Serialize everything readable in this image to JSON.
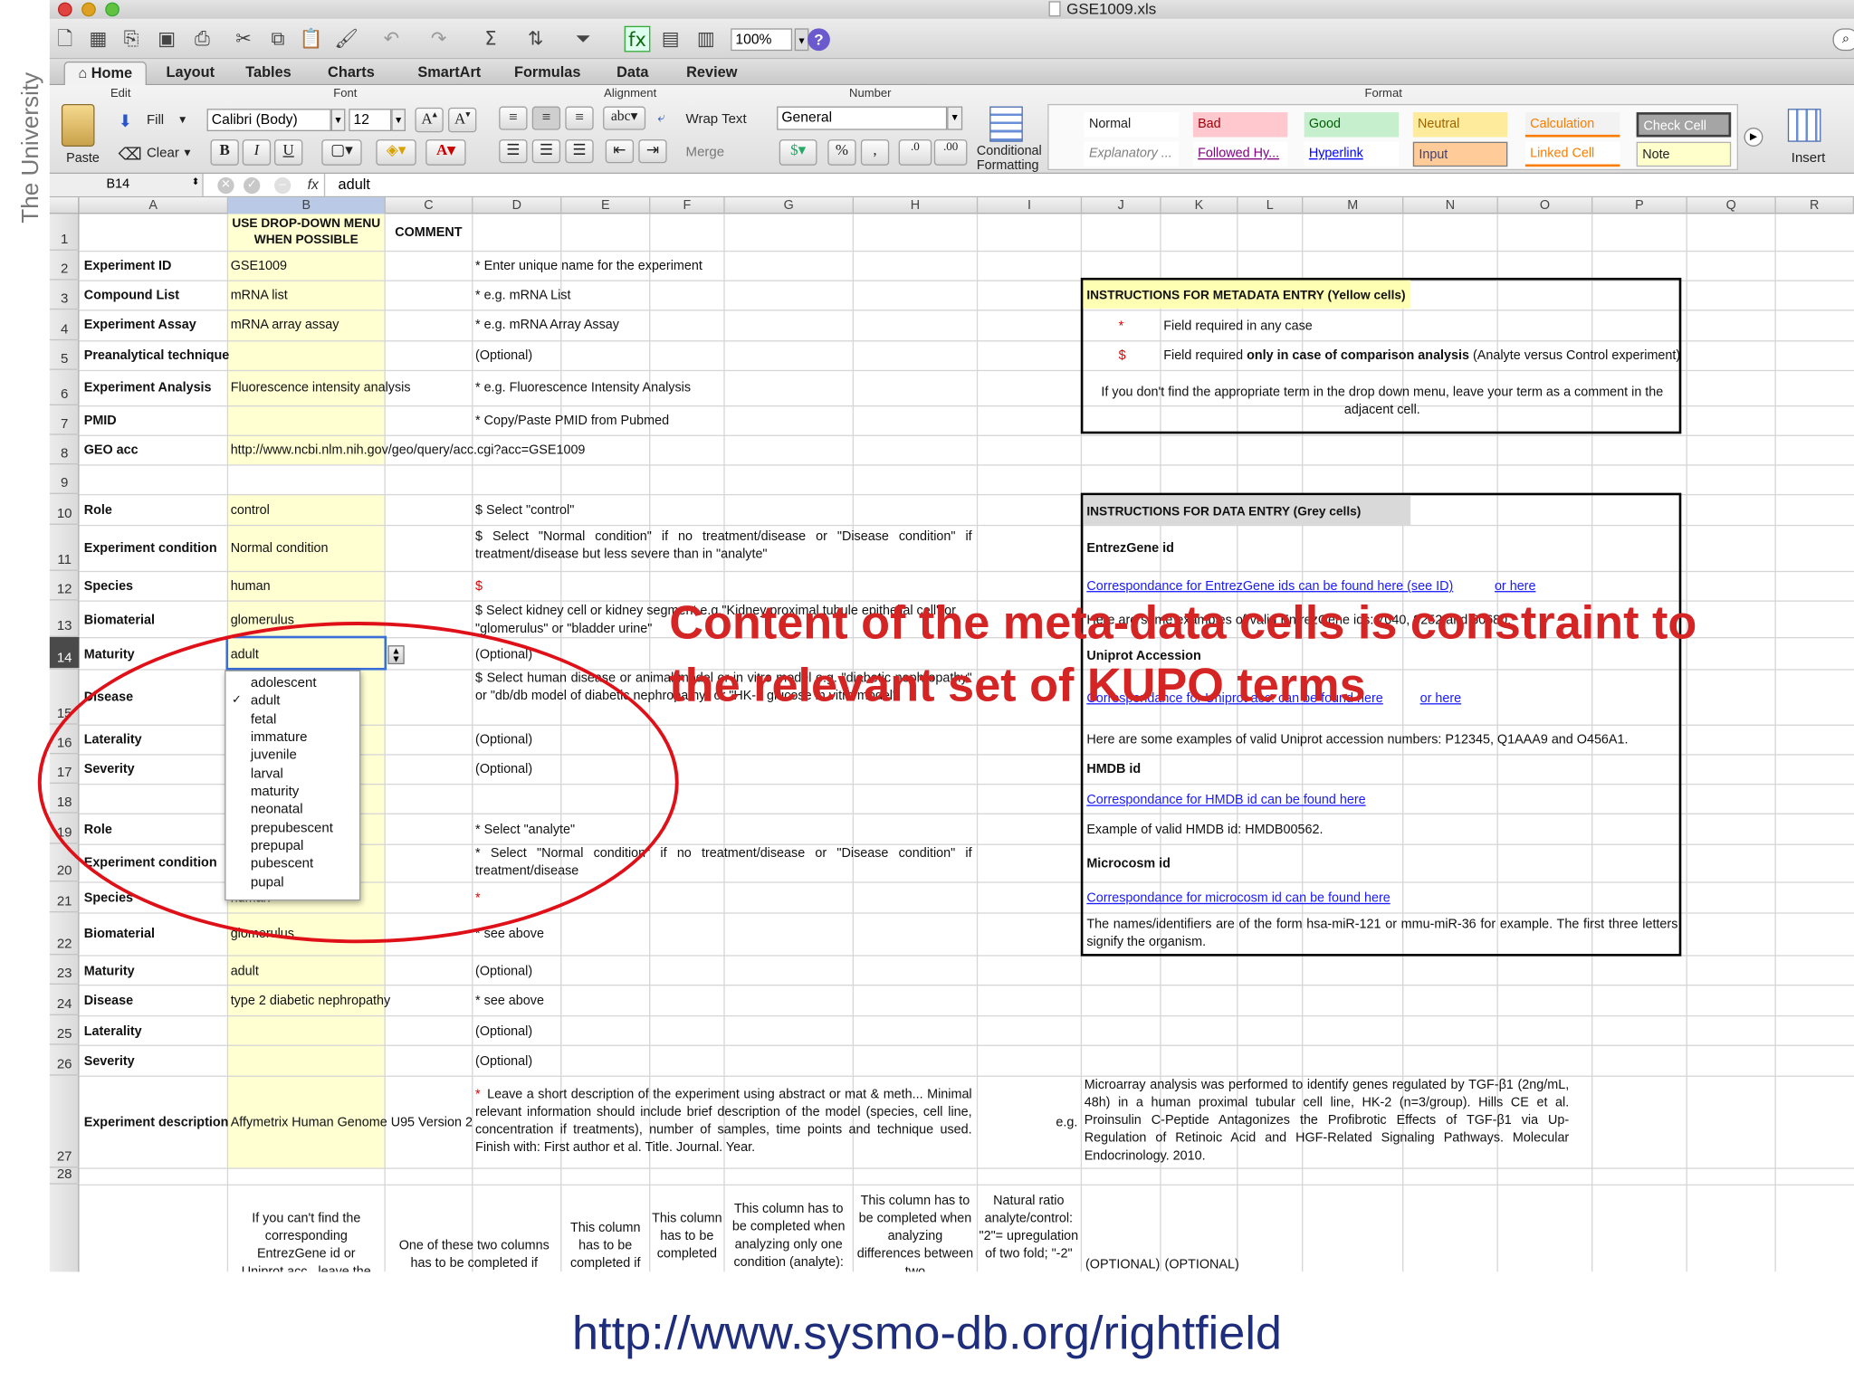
{
  "window": {
    "title": "GSE1009.xls",
    "zoom": "100%"
  },
  "side_text": "The University",
  "ribbon_tabs": [
    "Home",
    "Layout",
    "Tables",
    "Charts",
    "SmartArt",
    "Formulas",
    "Data",
    "Review"
  ],
  "ribbon": {
    "groups": {
      "edit": "Edit",
      "font": "Font",
      "alignment": "Alignment",
      "number": "Number",
      "format": "Format"
    },
    "paste": "Paste",
    "fill": "Fill",
    "clear": "Clear",
    "font_name": "Calibri (Body)",
    "font_size": "12",
    "wrap_text": "Wrap Text",
    "merge": "Merge",
    "abc": "abc",
    "number_format": "General",
    "conditional_formatting": "Conditional Formatting",
    "insert": "Insert",
    "styles": [
      {
        "label": "Normal",
        "bg": "#ffffff",
        "color": "#222222"
      },
      {
        "label": "Bad",
        "bg": "#ffc7ce",
        "color": "#9c0006"
      },
      {
        "label": "Good",
        "bg": "#c6efce",
        "color": "#006100"
      },
      {
        "label": "Neutral",
        "bg": "#ffeb9c",
        "color": "#9c6500"
      },
      {
        "label": "Calculation",
        "bg": "#f2f2f2",
        "color": "#fa7d00"
      },
      {
        "label": "Check Cell",
        "bg": "#a5a5a5",
        "color": "#ffffff"
      },
      {
        "label": "Explanatory ...",
        "bg": "#ffffff",
        "color": "#7f7f7f"
      },
      {
        "label": "Followed Hy...",
        "bg": "#ffffff",
        "color": "#800080"
      },
      {
        "label": "Hyperlink",
        "bg": "#ffffff",
        "color": "#0000ff"
      },
      {
        "label": "Input",
        "bg": "#ffcc99",
        "color": "#3f3f76"
      },
      {
        "label": "Linked Cell",
        "bg": "#ffffff",
        "color": "#fa7d00"
      },
      {
        "label": "Note",
        "bg": "#ffffcc",
        "color": "#222222"
      }
    ]
  },
  "formula_bar": {
    "cell_ref": "B14",
    "fx": "fx",
    "value": "adult"
  },
  "columns": [
    "A",
    "B",
    "C",
    "D",
    "E",
    "F",
    "G",
    "H",
    "I",
    "J",
    "K",
    "L",
    "M",
    "N",
    "O",
    "P",
    "Q",
    "R"
  ],
  "rows": [
    "1",
    "2",
    "3",
    "4",
    "5",
    "6",
    "7",
    "8",
    "9",
    "10",
    "11",
    "12",
    "13",
    "14",
    "15",
    "16",
    "17",
    "18",
    "19",
    "20",
    "21",
    "22",
    "23",
    "24",
    "25",
    "26",
    "27",
    "28"
  ],
  "header": {
    "b1": "USE DROP-DOWN MENU WHEN POSSIBLE",
    "c1": "COMMENT"
  },
  "labels": {
    "r2": "Experiment ID",
    "r3": "Compound List",
    "r4": "Experiment Assay",
    "r5": "Preanalytical technique",
    "r6": "Experiment Analysis",
    "r7": "PMID",
    "r8": "GEO acc",
    "r10": "Role",
    "r11": "Experiment condition",
    "r12": "Species",
    "r13": "Biomaterial",
    "r14": "Maturity",
    "r15": "Disease",
    "r16": "Laterality",
    "r17": "Severity",
    "r19": "Role",
    "r20": "Experiment condition",
    "r21": "Species",
    "r22": "Biomaterial",
    "r23": "Maturity",
    "r24": "Disease",
    "r25": "Laterality",
    "r26": "Severity",
    "r27": "Experiment description"
  },
  "values": {
    "r2": "GSE1009",
    "r3": "mRNA list",
    "r4": "mRNA array assay",
    "r6": "Fluorescence intensity analysis",
    "r8": "http://www.ncbi.nlm.nih.gov/geo/query/acc.cgi?acc=GSE1009",
    "r10": "control",
    "r11": "Normal condition",
    "r12": "human",
    "r13": "glomerulus",
    "r14": "adult",
    "r21": "human",
    "r22": "glomerulus",
    "r23": "adult",
    "r24": "type 2 diabetic nephropathy",
    "r27": "Affymetrix Human Genome U95 Version 2"
  },
  "comments": {
    "r2": "* Enter unique name for the experiment",
    "r3": "* e.g. mRNA List",
    "r4": "* e.g. mRNA Array Assay",
    "r5": "(Optional)",
    "r6": "* e.g. Fluorescence Intensity Analysis",
    "r7": "* Copy/Paste PMID from Pubmed",
    "r10": "$ Select \"control\"",
    "r11": "$ Select \"Normal condition\" if no treatment/disease or \"Disease condition\" if treatment/disease but less severe than in \"analyte\"",
    "r12": "$",
    "r13": "$ Select kidney cell or kidney segment e.g.\"Kidney proximal tubule epithelial cell\" or \"glomerulus\" or \"bladder urine\"",
    "r14": "(Optional)",
    "r15": "$ Select human disease or animal model or in vitro model e.g. \"diabetic nephropathy\" or \"db/db model of diabetic nephropathy\" or \"HK-2 glucose in vitro model\"",
    "r16": "(Optional)",
    "r17": "(Optional)",
    "r19": "* Select \"analyte\"",
    "r20": "* Select \"Normal condition\" if no treatment/disease or \"Disease condition\" if treatment/disease",
    "r21": "*",
    "r22": "* see above",
    "r23": "(Optional)",
    "r24": "* see above",
    "r25": "(Optional)",
    "r26": "(Optional)",
    "r27_star": "*",
    "r27": "Leave a short description of the experiment using abstract or mat & meth... Minimal relevant information should include brief description of the model (species, cell line, concentration if treatments), number of samples, time points and technique used. Finish with: First author et al. Title. Journal. Year."
  },
  "metadata_box": {
    "title": "INSTRUCTIONS FOR METADATA ENTRY (Yellow cells)",
    "star": "*",
    "star_text": "Field required in any case",
    "dollar": "$",
    "dollar_text_a": "Field required ",
    "dollar_text_b": "only in case of comparison analysis",
    "dollar_text_c": " (Analyte versus Control experiment)",
    "note": "If you don't find the appropriate term in the drop down menu, leave your term as a comment in the adjacent cell."
  },
  "data_box": {
    "title": "INSTRUCTIONS FOR DATA ENTRY (Grey cells)",
    "entrez_title": "EntrezGene id",
    "entrez_link": "Correspondance for EntrezGene ids can be found here (see ID)",
    "entrez_link2": "or here",
    "entrez_example": "Here are some examples of valid EntrezGene ids: 7040, 9252 and 60680.",
    "uniprot_title": "Uniprot Accession",
    "uniprot_link": "Correspondance for Uniprot acc. can be found here",
    "uniprot_link2": "or here",
    "uniprot_example": "Here are some examples of valid Uniprot accession numbers: P12345, Q1AAA9 and O456A1.",
    "hmdb_title": "HMDB id",
    "hmdb_link": "Correspondance for HMDB id can be found here",
    "hmdb_example": "Example of valid HMDB id: HMDB00562.",
    "micro_title": "Microcosm id",
    "micro_link": "Correspondance for microcosm id can be found here",
    "micro_example": "The names/identifiers are of the form hsa-miR-121 or mmu-miR-36 for example. The first three letters signify the organism."
  },
  "example27": {
    "eg": "e.g.",
    "text": "Microarray analysis was performed to identify genes regulated by TGF-β1 (2ng/mL, 48h) in a human proximal tubular cell line, HK-2 (n=3/group). Hills CE et al. Proinsulin C-Peptide Antagonizes the Profibrotic Effects of TGF-β1 via Up-Regulation of Retinoic Acid and HGF-Related Signaling Pathways. Molecular Endocrinology. 2010."
  },
  "row29": {
    "b": "If you can't find the corresponding EntrezGene id or Uniprot acc., leave the",
    "c": "One of these two columns has to be completed if",
    "e": "This column has to be completed if",
    "f": "This column has to be completed",
    "g": "This column has to be completed when analyzing only one condition (analyte):",
    "h": "This column has to be completed when analyzing differences between two",
    "i": "Natural ratio analyte/control: \"2\"= upregulation of two fold; \"-2\"",
    "j": "(OPTIONAL)",
    "k": "(OPTIONAL)"
  },
  "dropdown": {
    "check": "✓",
    "options": [
      "adolescent",
      "adult",
      "fetal",
      "immature",
      "juvenile",
      "larval",
      "maturity",
      "neonatal",
      "prepubescent",
      "prepupal",
      "pubescent",
      "pupal"
    ],
    "selected_index": 1
  },
  "overlay": {
    "line1": "Content of the meta-data cells is constraint to",
    "line2": "the relevant set of KUPO terms"
  },
  "footer_url": "http://www.sysmo-db.org/rightfield"
}
